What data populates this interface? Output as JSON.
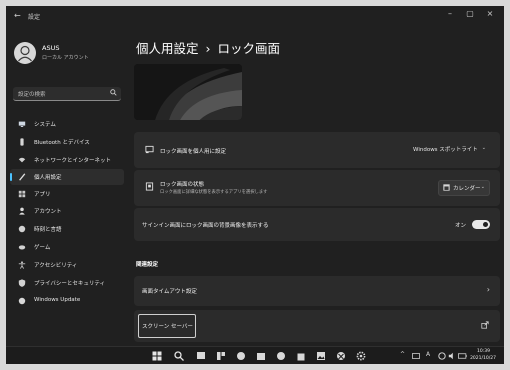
{
  "window": {
    "back_icon": "back-arrow-icon",
    "title": "設定",
    "minimize_glyph": "–",
    "maximize_glyph": "▢",
    "close_glyph": "×"
  },
  "account": {
    "name": "ASUS",
    "type": "ローカル アカウント",
    "avatar_icon": "user-avatar-icon"
  },
  "search": {
    "placeholder": "設定の検索",
    "icon": "search-icon"
  },
  "nav": [
    {
      "label": "システム",
      "icon": "monitor-icon"
    },
    {
      "label": "Bluetooth とデバイス",
      "icon": "bluetooth-icon"
    },
    {
      "label": "ネットワークとインターネット",
      "icon": "wifi-icon"
    },
    {
      "label": "個人用設定",
      "icon": "pen-icon",
      "selected": true
    },
    {
      "label": "アプリ",
      "icon": "apps-icon"
    },
    {
      "label": "アカウント",
      "icon": "person-icon"
    },
    {
      "label": "時刻と言語",
      "icon": "globe-icon"
    },
    {
      "label": "ゲーム",
      "icon": "gamepad-icon"
    },
    {
      "label": "アクセシビリティ",
      "icon": "accessibility-icon"
    },
    {
      "label": "プライバシーとセキュリティ",
      "icon": "shield-icon"
    },
    {
      "label": "Windows Update",
      "icon": "update-icon"
    }
  ],
  "page": {
    "breadcrumb_parent": "個人用設定",
    "breadcrumb_separator": "›",
    "breadcrumb_current": "ロック画面"
  },
  "settings": {
    "personalize": {
      "title": "ロック画面を個人用に設定",
      "value": "Windows スポットライト",
      "icon": "lock-screen-icon"
    },
    "status": {
      "title": "ロック画面の状態",
      "subtitle": "ロック画面に詳細な状態を表示するアプリを選択します",
      "value": "カレンダー",
      "icon": "lock-status-icon",
      "value_icon": "calendar-icon"
    },
    "signin_background": {
      "title": "サインイン画面にロック画面の背景画像を表示する",
      "state": "オン",
      "on": true
    }
  },
  "related": {
    "heading": "関連設定",
    "timeout": {
      "label": "画面タイムアウト設定",
      "chevron": "›"
    },
    "screensaver": {
      "label": "スクリーン セーバー",
      "icon": "external-link-icon"
    }
  },
  "taskbar": {
    "icons": [
      "start-icon",
      "search-icon",
      "task-view-icon",
      "widgets-icon",
      "chat-icon",
      "file-explorer-icon",
      "edge-icon",
      "store-icon",
      "photos-icon",
      "xbox-icon",
      "settings-icon"
    ],
    "tray_icons": [
      "chevron-up-icon",
      "keyboard-icon",
      "ime-icon",
      "network-icon",
      "volume-icon",
      "battery-icon"
    ],
    "time": "10:39",
    "date": "2021/10/27"
  },
  "colors": {
    "accent": "#4cc2ff",
    "background": "#202020",
    "card": "#2b2b2b"
  }
}
